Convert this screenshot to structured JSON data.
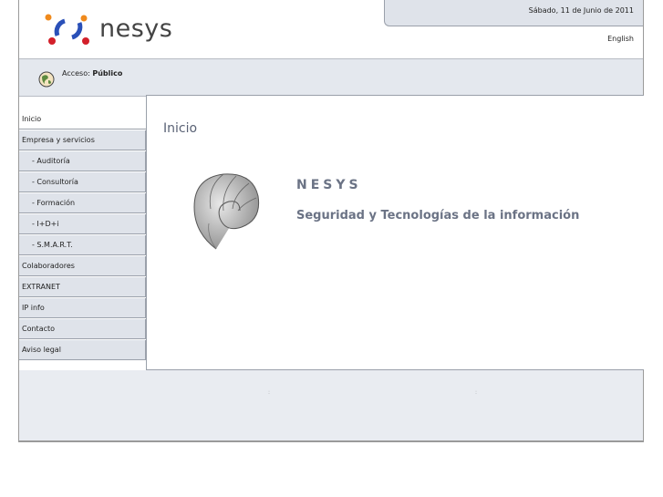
{
  "header": {
    "brand_name": "nesys",
    "date": "Sábado, 11 de Junio de 2011",
    "language_link": "English"
  },
  "access": {
    "label": "Acceso:",
    "value": "Público"
  },
  "nav": {
    "items": [
      {
        "label": "Inicio"
      },
      {
        "label": "Empresa y servicios"
      },
      {
        "label": "- Auditoría"
      },
      {
        "label": "- Consultoría"
      },
      {
        "label": "- Formación"
      },
      {
        "label": "- I+D+i"
      },
      {
        "label": "- S.M.A.R.T."
      },
      {
        "label": "Colaboradores"
      },
      {
        "label": "EXTRANET"
      },
      {
        "label": "IP info"
      },
      {
        "label": "Contacto"
      },
      {
        "label": "Aviso legal"
      }
    ]
  },
  "main": {
    "title": "Inicio",
    "brand": "NESYS",
    "tagline": "Seguridad y Tecnologías de la información"
  },
  "footer": {
    "separator_1": ":",
    "separator_2": ":"
  },
  "colors": {
    "accent_text": "#6b7385",
    "nav_bg": "#dfe3ea",
    "logo_orange": "#f08a1c",
    "logo_blue": "#2a50b8",
    "logo_red": "#d3202a"
  }
}
